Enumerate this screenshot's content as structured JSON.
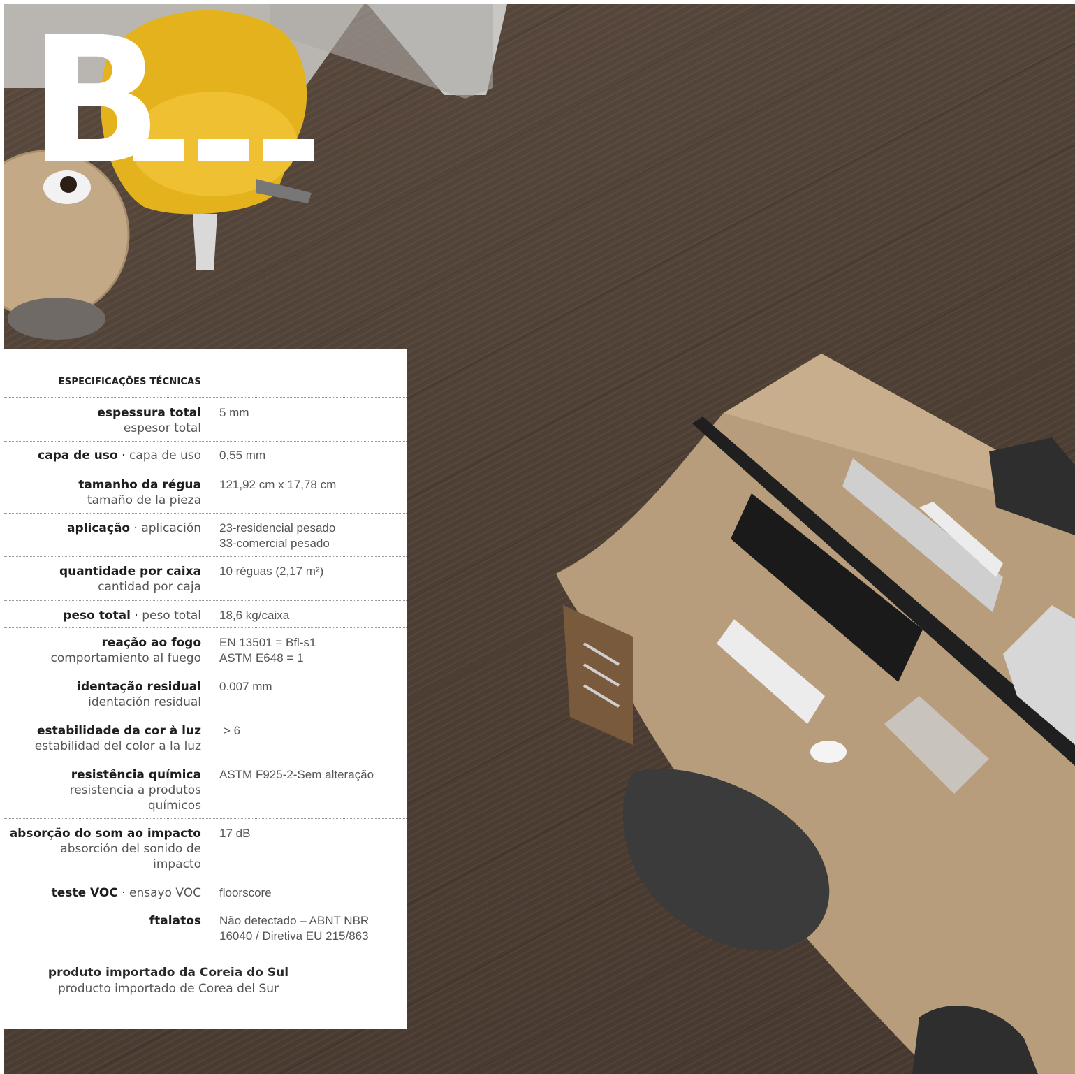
{
  "brand": {
    "letter": "B"
  },
  "specs": {
    "heading": "ESPECIFICAÇÕES TÉCNICAS",
    "rows": [
      {
        "pt": "espessura total",
        "es": "espesor total",
        "value1": "5 mm",
        "value2": ""
      },
      {
        "pt": "capa de uso",
        "es": "capa de uso",
        "value1": "0,55 mm",
        "value2": ""
      },
      {
        "pt": "tamanho da régua",
        "es": "tamaño de la pieza",
        "value1": "121,92 cm x 17,78 cm",
        "value2": ""
      },
      {
        "pt": "aplicação",
        "es": "aplicación",
        "value1": "23-residencial pesado",
        "value2": "33-comercial pesado"
      },
      {
        "pt": "quantidade por caixa",
        "es": "cantidad por caja",
        "value1": "10 réguas (2,17 m²)",
        "value2": ""
      },
      {
        "pt": "peso total",
        "es": "peso total",
        "value1": "18,6 kg/caixa",
        "value2": ""
      },
      {
        "pt": "reação ao fogo",
        "es": "comportamiento al fuego",
        "value1": "EN 13501 = Bfl-s1",
        "value2": "ASTM E648 = 1"
      },
      {
        "pt": "identação residual",
        "es": "identación residual",
        "value1": "0.007 mm",
        "value2": ""
      },
      {
        "pt": "estabilidade da cor à luz",
        "es": "estabilidad del color a la luz",
        "value1": "> 6",
        "value2": ""
      },
      {
        "pt": "resistência química",
        "es": "resistencia a produtos químicos",
        "value1": "ASTM F925-2-Sem alteração",
        "value2": ""
      },
      {
        "pt": "absorção do som ao impacto",
        "es": "absorción del sonido de impacto",
        "value1": "17 dB",
        "value2": ""
      },
      {
        "pt": "teste VOC",
        "es": "ensayo VOC",
        "value1": "floorscore",
        "value2": ""
      },
      {
        "pt": "ftalatos",
        "es": "",
        "value1": "Não detectado – ABNT NBR",
        "value2": "16040 / Diretiva EU 215/863"
      }
    ],
    "footer_pt": "produto importado da Coreia do Sul",
    "footer_es": "producto importado de Corea del Sur"
  }
}
